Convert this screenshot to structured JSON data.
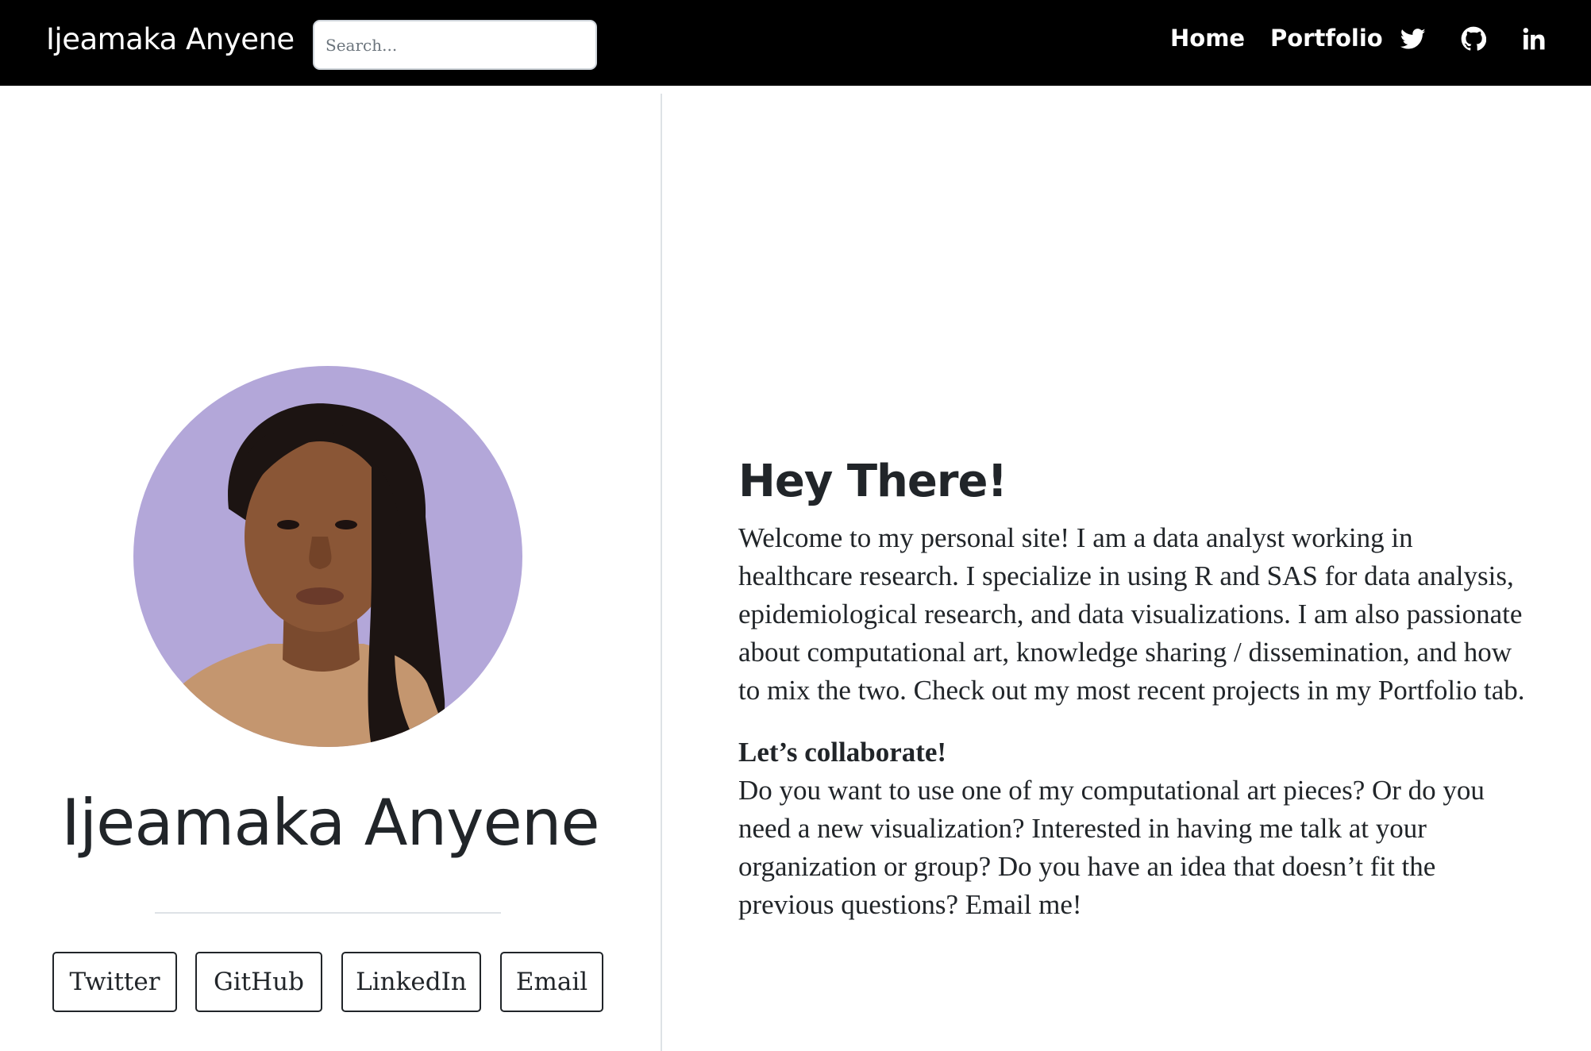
{
  "nav": {
    "brand": "Ijeamaka Anyene",
    "search_placeholder": "Search...",
    "links": [
      "Home",
      "Portfolio"
    ],
    "icons": [
      "twitter-icon",
      "github-icon",
      "linkedin-icon"
    ]
  },
  "profile": {
    "name": "Ijeamaka Anyene",
    "buttons": [
      "Twitter",
      "GitHub",
      "LinkedIn",
      "Email"
    ]
  },
  "content": {
    "heading": "Hey There!",
    "intro": "Welcome to my personal site! I am a data analyst working in healthcare research. I specialize in using R and SAS for data analysis, epidemiological research, and data visualizations. I am also passionate about computational art, knowledge sharing / dissemination, and how to mix the two. Check out my most recent projects in my Portfolio tab.",
    "collab_heading": "Let’s collaborate!",
    "collab_text": "Do you want to use one of my computational art pieces? Or do you need a new visualization? Interested in having me talk at your organization or group? Do you have an idea that doesn’t fit the previous questions? Email me!"
  },
  "colors": {
    "navbar_bg": "#000000",
    "text": "#212529",
    "avatar_bg": "#b3a7d9",
    "divider": "#dee2e6"
  }
}
